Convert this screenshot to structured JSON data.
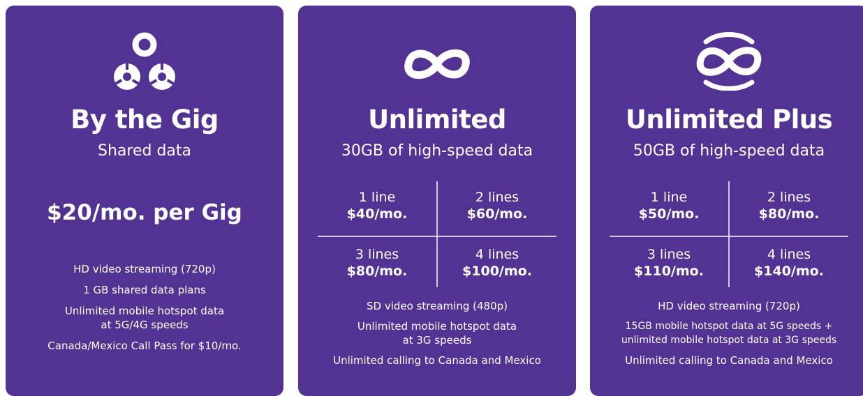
{
  "plans": [
    {
      "icon": "shared-data-icon",
      "title": "By the Gig",
      "subtitle": "Shared data",
      "price": "$20/mo. per Gig",
      "features": [
        "HD video streaming (720p)",
        "1 GB shared data plans",
        "Unlimited mobile hotspot data\nat 5G/4G speeds",
        "Canada/Mexico Call Pass for $10/mo."
      ]
    },
    {
      "icon": "infinity-icon",
      "title": "Unlimited",
      "subtitle": "30GB of high-speed data",
      "pricing": [
        {
          "lines": "1 line",
          "price": "$40/mo."
        },
        {
          "lines": "2 lines",
          "price": "$60/mo."
        },
        {
          "lines": "3 lines",
          "price": "$80/mo."
        },
        {
          "lines": "4 lines",
          "price": "$100/mo."
        }
      ],
      "features": [
        "SD video streaming (480p)",
        "Unlimited mobile hotspot data\nat 3G speeds",
        "Unlimited calling to Canada and Mexico"
      ]
    },
    {
      "icon": "infinity-plus-icon",
      "title": "Unlimited Plus",
      "subtitle": "50GB of high-speed data",
      "pricing": [
        {
          "lines": "1 line",
          "price": "$50/mo."
        },
        {
          "lines": "2 lines",
          "price": "$80/mo."
        },
        {
          "lines": "3 lines",
          "price": "$110/mo."
        },
        {
          "lines": "4 lines",
          "price": "$140/mo."
        }
      ],
      "features": [
        "HD video streaming (720p)",
        "15GB mobile hotspot data at 5G speeds +\nunlimited mobile hotspot data at 3G speeds",
        "Unlimited calling to Canada and Mexico"
      ]
    }
  ],
  "colors": {
    "card_background": "#523293",
    "text": "#ffffff"
  }
}
